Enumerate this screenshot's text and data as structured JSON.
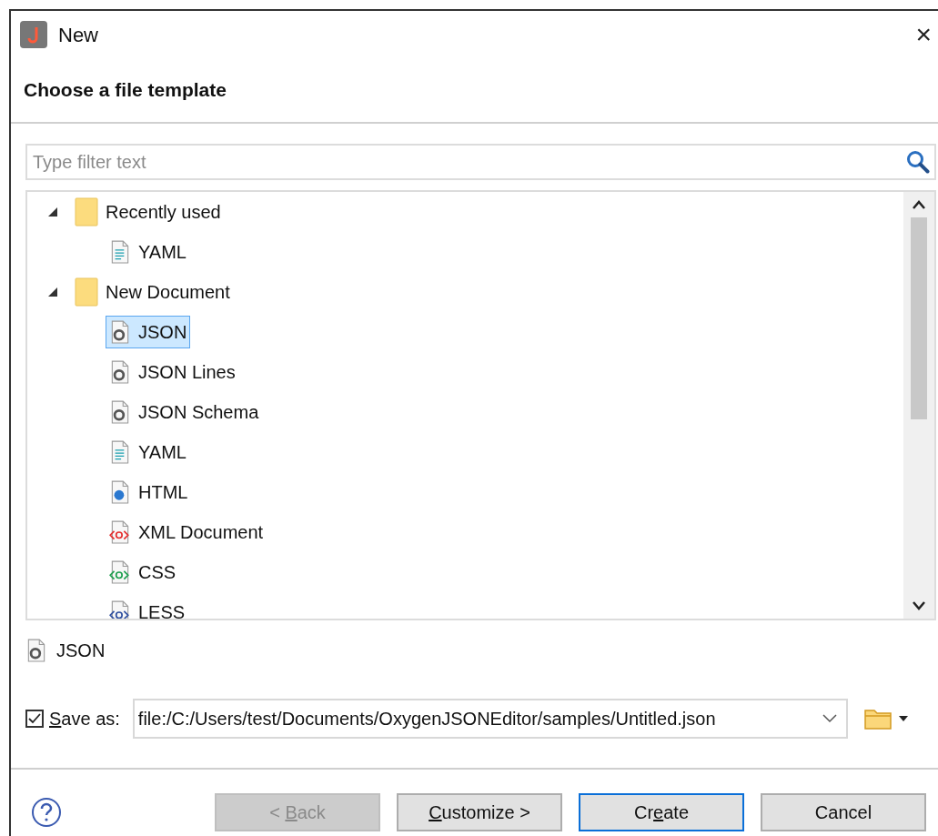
{
  "window": {
    "title": "New",
    "close": "×"
  },
  "header": "Choose a file template",
  "filter": {
    "placeholder": "Type filter text"
  },
  "tree": [
    {
      "label": "Recently used",
      "kind": "folder",
      "expanded": true,
      "selected": false,
      "children": [
        {
          "label": "YAML",
          "kind": "text",
          "selected": false
        }
      ]
    },
    {
      "label": "New Document",
      "kind": "folder",
      "expanded": true,
      "selected": false,
      "children": [
        {
          "label": "JSON",
          "kind": "json",
          "selected": true
        },
        {
          "label": "JSON Lines",
          "kind": "json",
          "selected": false
        },
        {
          "label": "JSON Schema",
          "kind": "json",
          "selected": false
        },
        {
          "label": "YAML",
          "kind": "text",
          "selected": false
        },
        {
          "label": "HTML",
          "kind": "html",
          "selected": false
        },
        {
          "label": "XML Document",
          "kind": "xml",
          "selected": false
        },
        {
          "label": "CSS",
          "kind": "css",
          "selected": false
        },
        {
          "label": "LESS",
          "kind": "less",
          "selected": false
        }
      ]
    }
  ],
  "selected_template": {
    "label": "JSON",
    "kind": "json"
  },
  "save_as": {
    "checked": true,
    "label": {
      "key": "S",
      "post": "ave as:"
    },
    "value": "file:/C:/Users/test/Documents/OxygenJSONEditor/samples/Untitled.json"
  },
  "buttons": [
    {
      "pre": "< ",
      "key": "B",
      "post": "ack",
      "disabled": true,
      "default": false
    },
    {
      "key": "C",
      "post": "ustomize >",
      "disabled": false,
      "default": false
    },
    {
      "pre": "Cr",
      "key": "e",
      "post": "ate",
      "disabled": false,
      "default": true
    },
    {
      "pre": "Cancel",
      "disabled": false,
      "default": false
    }
  ]
}
